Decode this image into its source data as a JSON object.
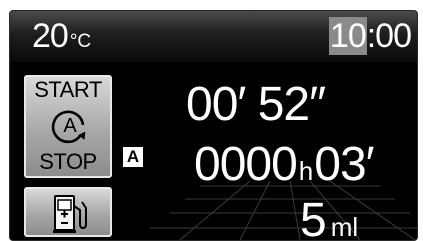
{
  "status": {
    "temperature_value": "20",
    "temperature_unit": "°C",
    "clock_hour": "10",
    "clock_rest": ":00"
  },
  "buttons": {
    "start_stop": {
      "top_label": "START",
      "bottom_label": "STOP",
      "icon": "auto-idle-stop-icon",
      "icon_letter": "A"
    },
    "fuel": {
      "icon": "fuel-pump-icon"
    }
  },
  "badge": {
    "label": "A"
  },
  "readouts": {
    "elapsed": "00′ 52″",
    "duration_hours": "0000",
    "duration_hours_unit": "h",
    "duration_minutes": "03′",
    "fuel_saved_value": "5",
    "fuel_saved_unit": "ml"
  },
  "colors": {
    "background": "#000000",
    "text": "#ffffff",
    "button_face": "#b0b0b0",
    "clock_highlight": "#8a8a8a"
  }
}
